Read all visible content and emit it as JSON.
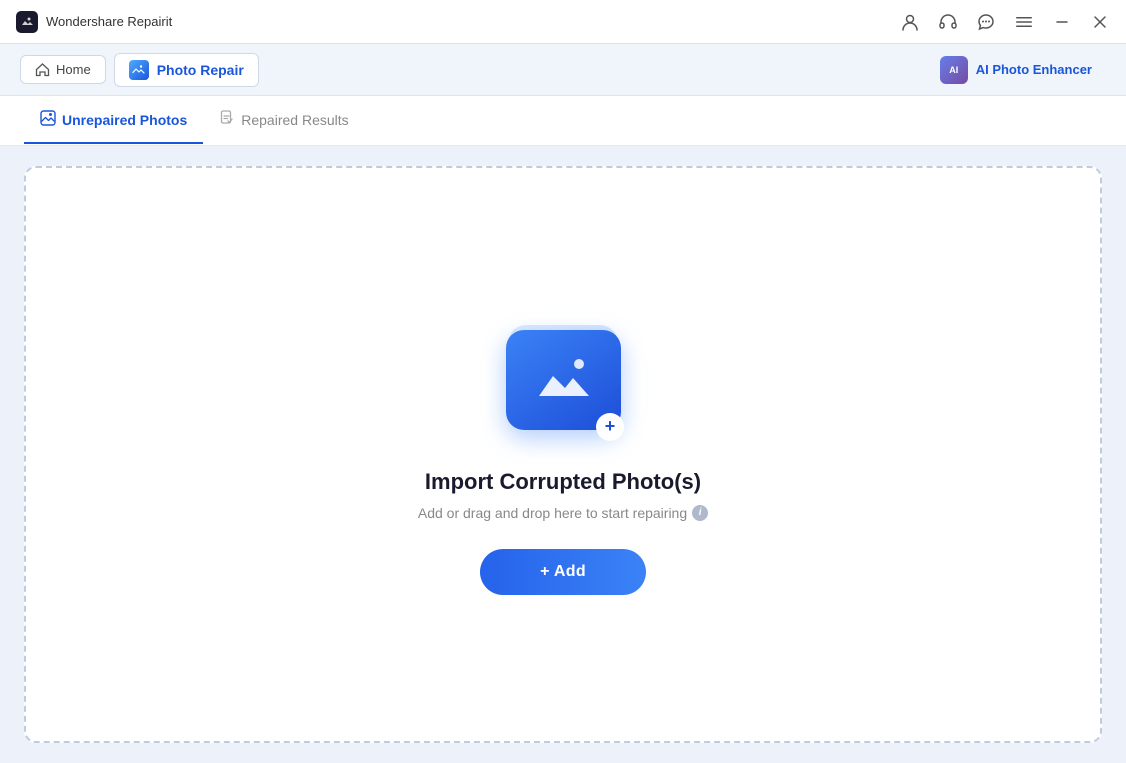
{
  "titleBar": {
    "appName": "Wondershare Repairit",
    "icons": [
      "user",
      "headphones",
      "chat",
      "menu"
    ]
  },
  "navBar": {
    "homeLabel": "Home",
    "photoRepairLabel": "Photo Repair",
    "aiEnhancerLabel": "AI Photo Enhancer"
  },
  "tabs": {
    "unrepaired": "Unrepaired Photos",
    "repaired": "Repaired Results"
  },
  "dropZone": {
    "title": "Import Corrupted Photo(s)",
    "subtitle": "Add or drag and drop here to start repairing",
    "addButton": "+ Add"
  }
}
